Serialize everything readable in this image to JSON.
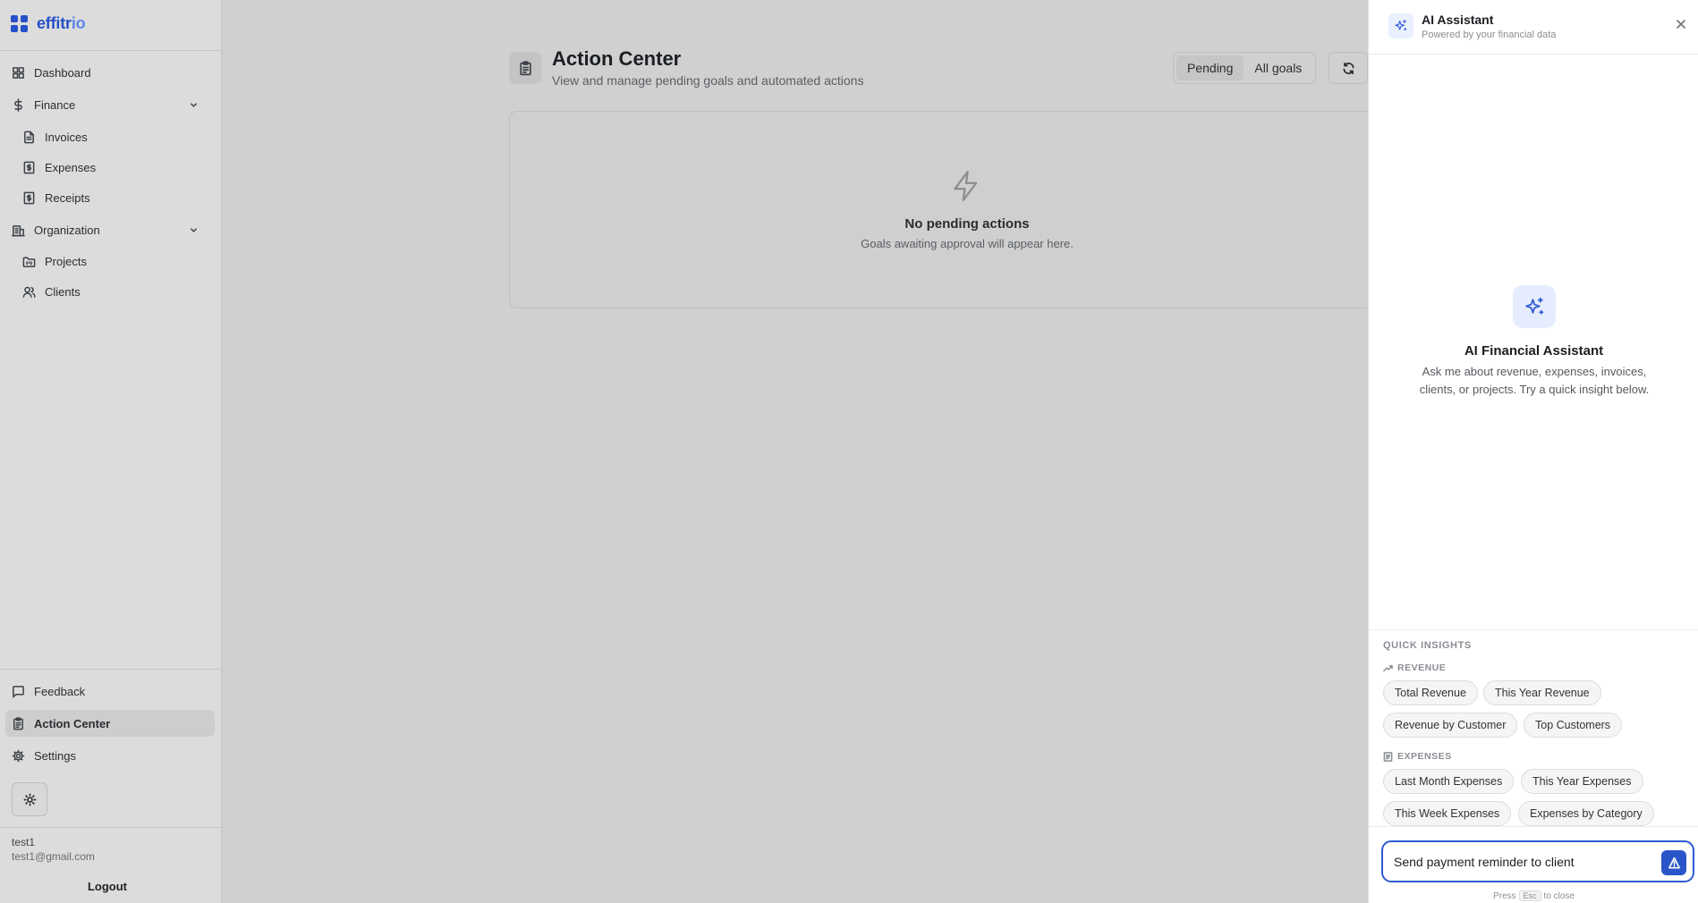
{
  "app": {
    "logo_main": "effitr",
    "logo_suffix": "io"
  },
  "sidebar": {
    "items": [
      {
        "label": "Dashboard",
        "icon": "layout-grid-icon"
      },
      {
        "label": "Finance",
        "icon": "dollar-sign-icon",
        "expanded": true
      },
      {
        "label": "Invoices",
        "icon": "file-text-icon"
      },
      {
        "label": "Expenses",
        "icon": "receipt-dollar-icon"
      },
      {
        "label": "Receipts",
        "icon": "receipt-dollar-icon"
      },
      {
        "label": "Organization",
        "icon": "building-icon",
        "expanded": true
      },
      {
        "label": "Projects",
        "icon": "folder-kanban-icon"
      },
      {
        "label": "Clients",
        "icon": "users-icon"
      }
    ],
    "bottom_items": [
      {
        "label": "Feedback",
        "icon": "message-square-icon"
      },
      {
        "label": "Action Center",
        "icon": "clipboard-list-icon",
        "active": true
      },
      {
        "label": "Settings",
        "icon": "gear-icon"
      }
    ],
    "theme_toggle_icon": "sun-icon",
    "user": {
      "name": "test1",
      "email": "test1@gmail.com"
    },
    "logout_label": "Logout"
  },
  "main": {
    "title": "Action Center",
    "subtitle": "View and manage pending goals and automated actions",
    "filters": [
      "Pending",
      "All goals"
    ],
    "selected_filter": "Pending",
    "empty_state": {
      "icon": "zap-icon",
      "title": "No pending actions",
      "description": "Goals awaiting approval will appear here."
    }
  },
  "assistant": {
    "title": "AI Assistant",
    "subtitle": "Powered by your financial data",
    "hero_title": "AI Financial Assistant",
    "hero_description": "Ask me about revenue, expenses, invoices, clients, or projects. Try a quick insight below.",
    "quick_insights_label": "QUICK INSIGHTS",
    "categories": [
      {
        "label": "REVENUE",
        "chips": [
          "Total Revenue",
          "This Year Revenue",
          "Revenue by Customer",
          "Top Customers"
        ]
      },
      {
        "label": "EXPENSES",
        "chips": [
          "Last Month Expenses",
          "This Year Expenses",
          "This Week Expenses",
          "Expenses by Category"
        ]
      }
    ],
    "input_value": "Send payment reminder to client",
    "hint_prefix": "Press",
    "hint_key": "Esc",
    "hint_suffix": "to close"
  },
  "colors": {
    "accent": "#2f5bd3",
    "sidebar_bg": "#dcdcdc",
    "overlay_bg": "#d0d0d0"
  }
}
